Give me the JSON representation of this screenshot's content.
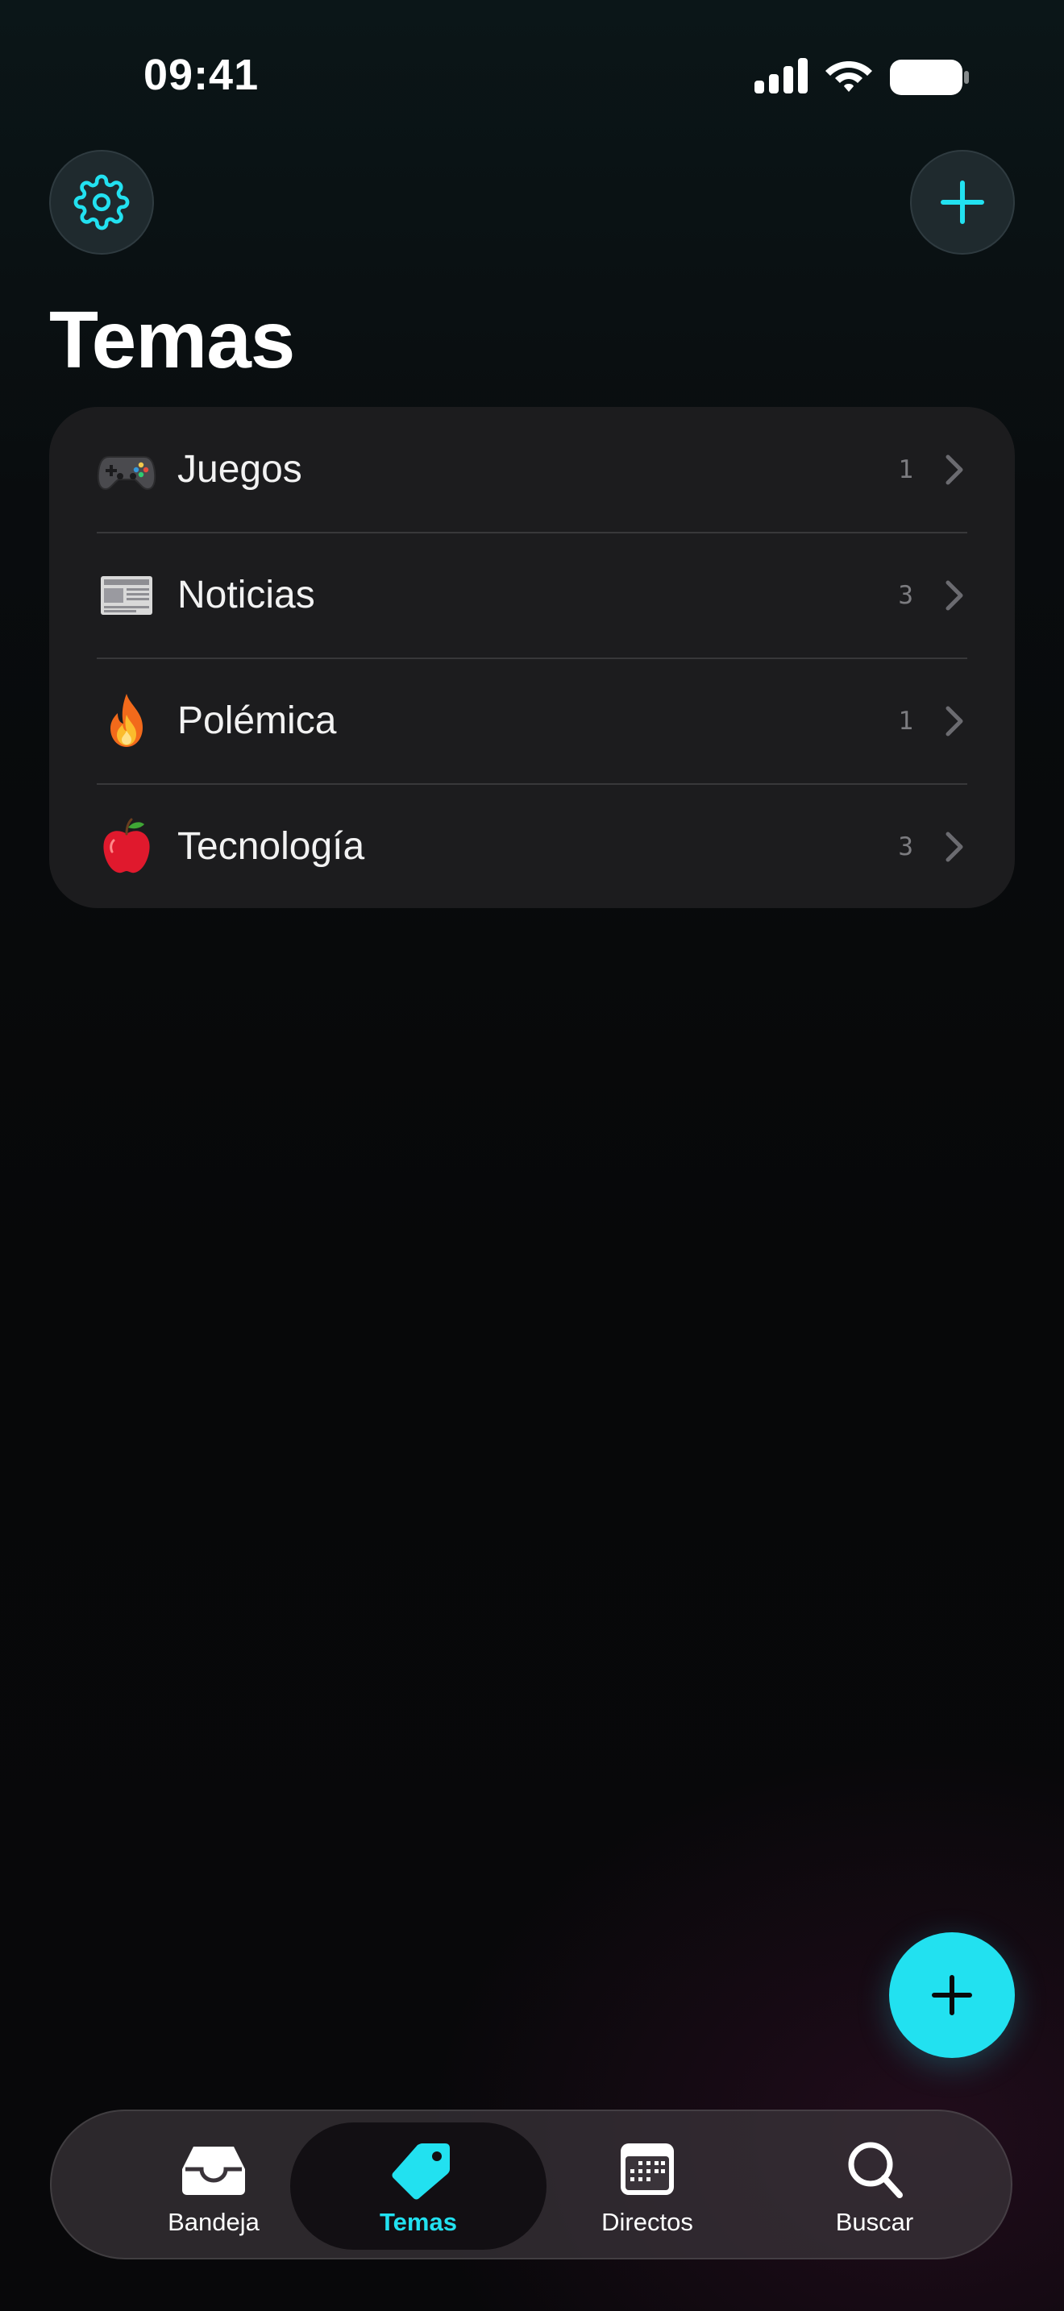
{
  "status_bar": {
    "time": "09:41"
  },
  "header": {
    "title": "Temas",
    "settings_icon": "gear-icon",
    "add_icon": "plus-icon"
  },
  "topics": [
    {
      "emoji": "video-game-controller",
      "label": "Juegos",
      "count": "1"
    },
    {
      "emoji": "newspaper",
      "label": "Noticias",
      "count": "3"
    },
    {
      "emoji": "fire",
      "label": "Polémica",
      "count": "1"
    },
    {
      "emoji": "red-apple",
      "label": "Tecnología",
      "count": "3"
    }
  ],
  "fab": {
    "icon": "plus-icon"
  },
  "tabs": [
    {
      "label": "Bandeja",
      "icon": "inbox-icon",
      "active": false
    },
    {
      "label": "Temas",
      "icon": "tag-icon",
      "active": true
    },
    {
      "label": "Directos",
      "icon": "calendar-icon",
      "active": false
    },
    {
      "label": "Buscar",
      "icon": "search-icon",
      "active": false
    }
  ],
  "colors": {
    "accent": "#22e1f0",
    "card": "#1c1c1e",
    "background": "#08090a"
  }
}
